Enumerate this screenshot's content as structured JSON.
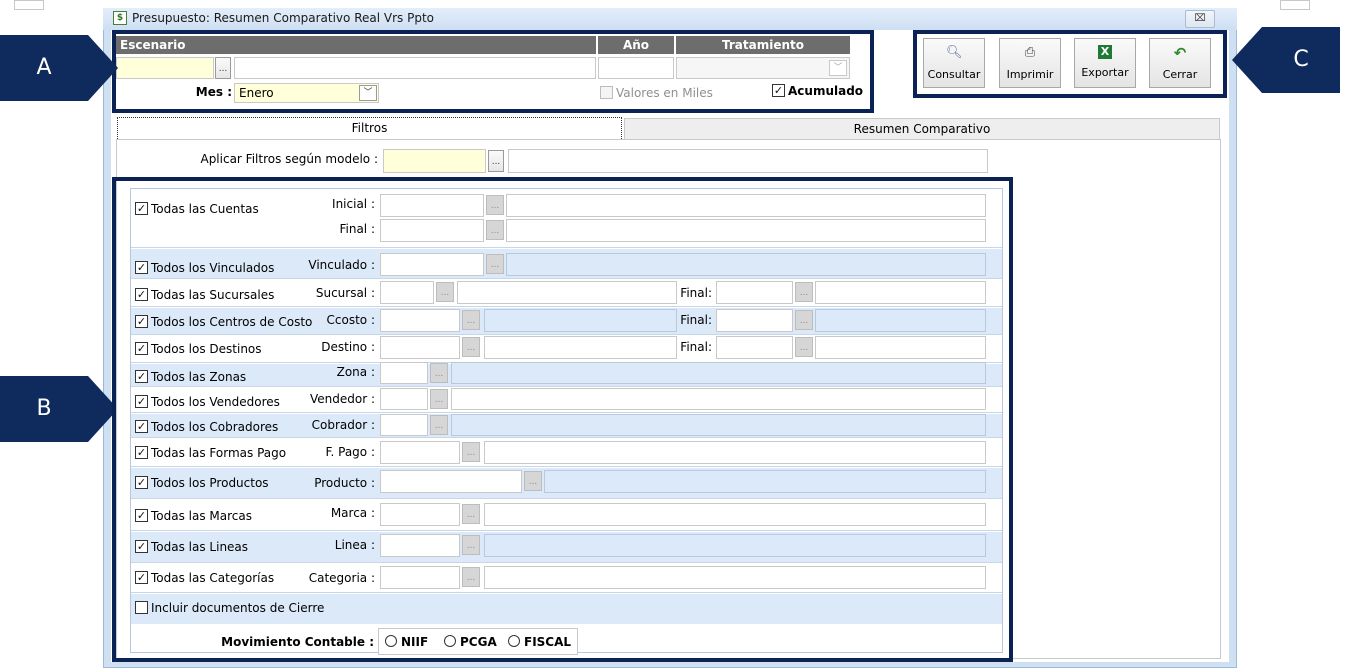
{
  "window": {
    "title": "Presupuesto: Resumen Comparativo Real Vrs Ppto",
    "close_glyph": "⌧"
  },
  "callouts": {
    "a": "A",
    "b": "B",
    "c": "C"
  },
  "header": {
    "escenario_label": "Escenario",
    "anio_label": "Año",
    "tratamiento_label": "Tratamiento",
    "mes_label": "Mes :",
    "mes_value": "Enero",
    "valores_miles_label": "Valores en  Miles",
    "acumulado_label": "Acumulado"
  },
  "toolbar": {
    "consultar": "Consultar",
    "imprimir": "Imprimir",
    "exportar": "Exportar",
    "cerrar": "Cerrar"
  },
  "tabs": {
    "filtros": "Filtros",
    "resumen": "Resumen Comparativo"
  },
  "aplicar_label": "Aplicar Filtros según modelo :",
  "ellipsis": "...",
  "check_glyph": "✓",
  "filters": {
    "cuentas": {
      "check": "Todas las Cuentas",
      "inicial": "Inicial :",
      "final": "Final :"
    },
    "vinculados": {
      "check": "Todos los Vinculados",
      "label": "Vinculado :"
    },
    "sucursales": {
      "check": "Todas las Sucursales",
      "label": "Sucursal :",
      "final": "Final:"
    },
    "centros": {
      "check": "Todos los Centros de Costo",
      "label": "Ccosto :",
      "final": "Final:"
    },
    "destinos": {
      "check": "Todos los Destinos",
      "label": "Destino :",
      "final": "Final:"
    },
    "zonas": {
      "check": "Todos las Zonas",
      "label": "Zona :"
    },
    "vendedores": {
      "check": "Todos los Vendedores",
      "label": "Vendedor :"
    },
    "cobradores": {
      "check": "Todos los Cobradores",
      "label": "Cobrador :"
    },
    "formas_pago": {
      "check": "Todas las Formas Pago",
      "label": "F. Pago :"
    },
    "productos": {
      "check": "Todos los Productos",
      "label": "Producto :"
    },
    "marcas": {
      "check": "Todas las Marcas",
      "label": "Marca :"
    },
    "lineas": {
      "check": "Todas las Lineas",
      "label": "Linea :"
    },
    "categorias": {
      "check": "Todas las Categorías",
      "label": "Categoria :"
    },
    "incluir_cierre": "Incluir documentos de Cierre"
  },
  "movimiento": {
    "label": "Movimiento Contable :",
    "niif": "NIIF",
    "pcga": "PCGA",
    "fiscal": "FISCAL"
  },
  "colors": {
    "navy": "#0b2254",
    "callout": "#0f2a5c",
    "row_blue": "#dbe9f8",
    "input_yellow": "#ffffd9",
    "header_gray": "#6d6d6d"
  }
}
